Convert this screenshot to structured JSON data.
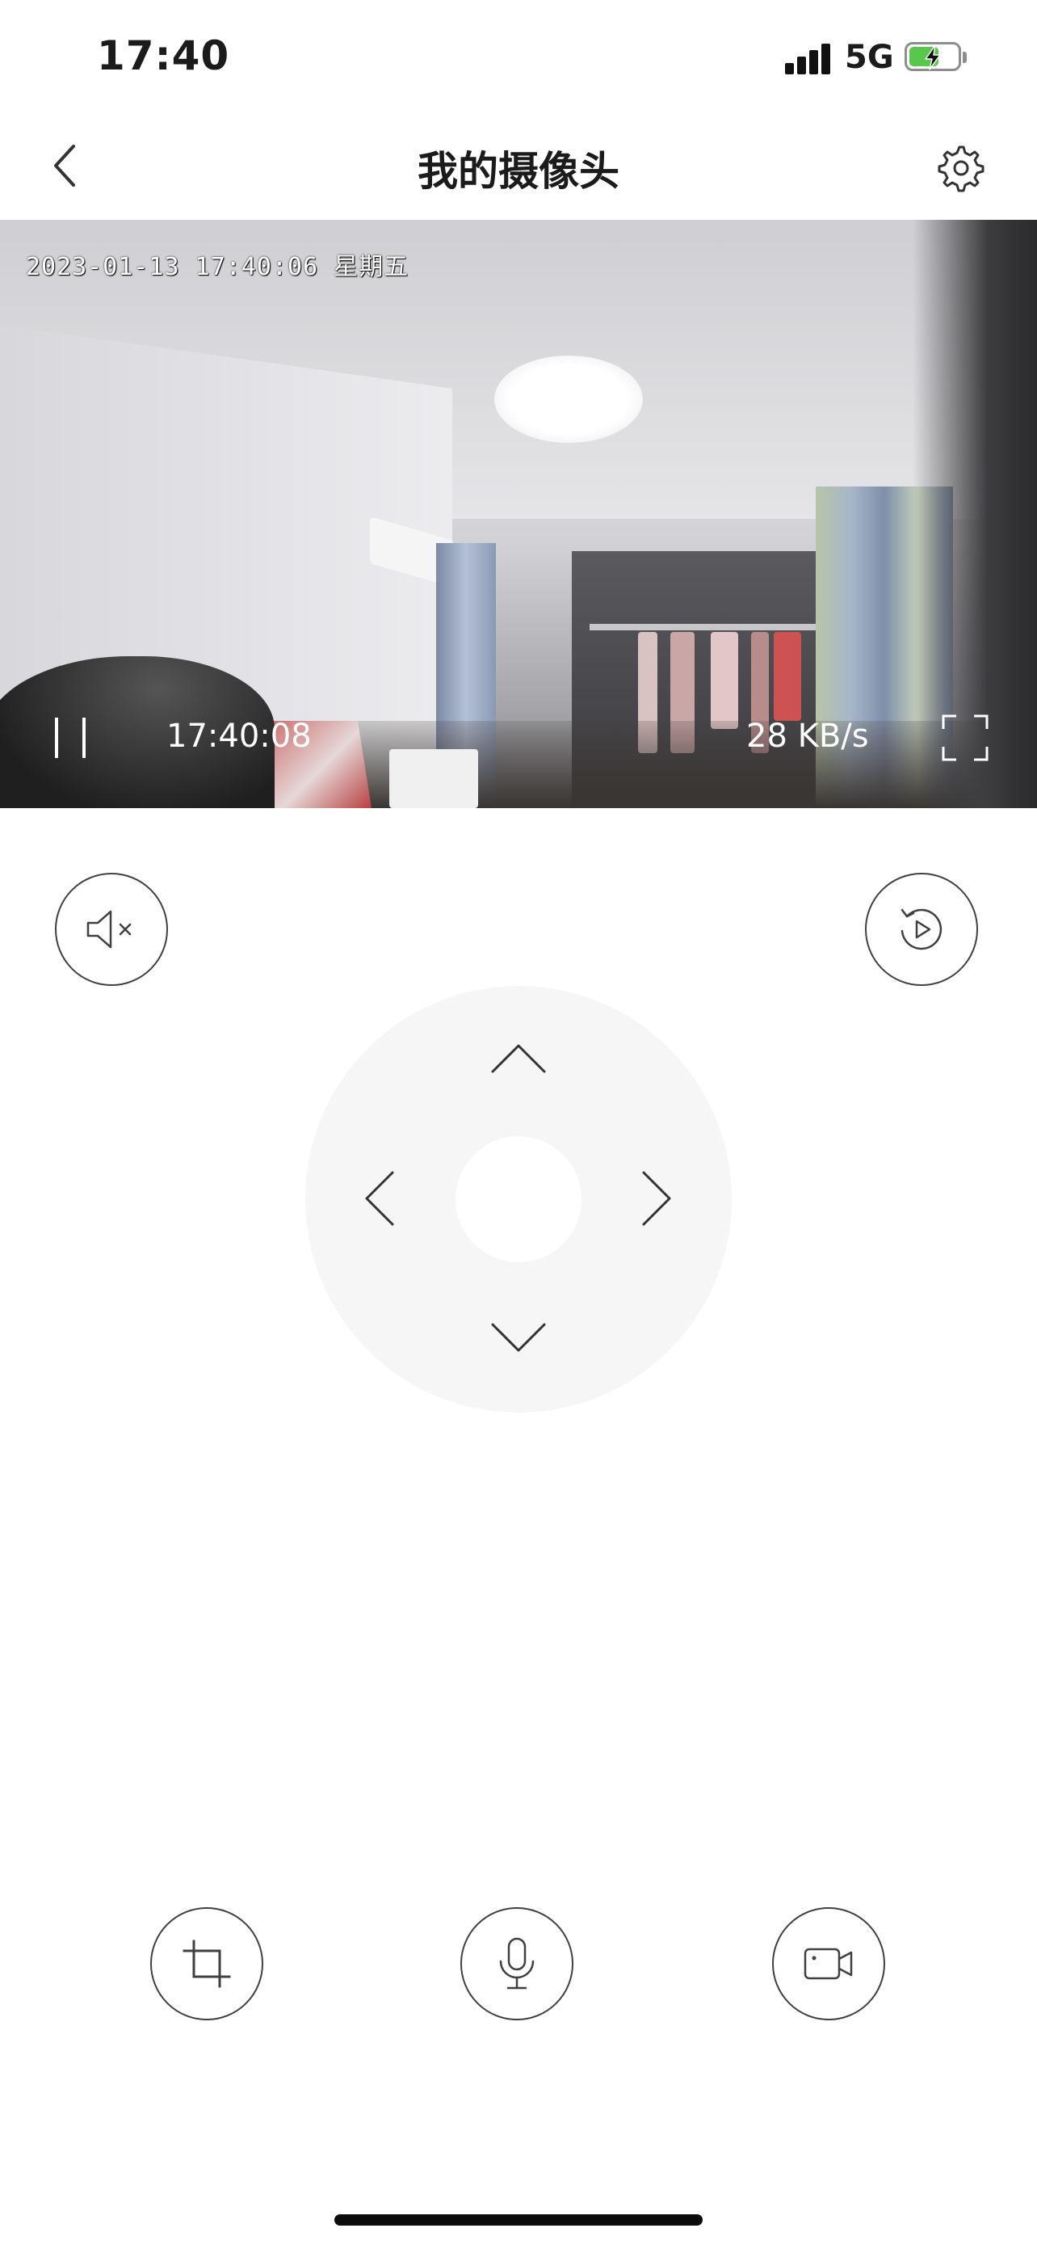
{
  "status_bar": {
    "time": "17:40",
    "network": "5G",
    "battery_level": 0.55,
    "battery_charging": true,
    "icons": [
      "signal-icon",
      "battery-charging-icon"
    ]
  },
  "nav": {
    "title": "我的摄像头",
    "back_icon": "chevron-left-icon",
    "settings_icon": "gear-icon"
  },
  "video": {
    "osd_timestamp": "2023-01-13 17:40:06 星期五",
    "live_time": "17:40:08",
    "bitrate": "28 KB/s",
    "pause_icon": "pause-icon",
    "fullscreen_icon": "fullscreen-icon"
  },
  "controls": {
    "mute_icon": "speaker-muted-icon",
    "playback_icon": "replay-icon",
    "dpad": [
      "arrow-up-icon",
      "arrow-down-icon",
      "arrow-left-icon",
      "arrow-right-icon"
    ],
    "bottom_icons": [
      "crop-screenshot-icon",
      "microphone-icon",
      "video-record-icon"
    ]
  },
  "colors": {
    "icon_stroke": "#404040",
    "dpad_bg": "#f6f6f6",
    "battery_green": "#59c64d",
    "text": "#1b1b1b"
  }
}
